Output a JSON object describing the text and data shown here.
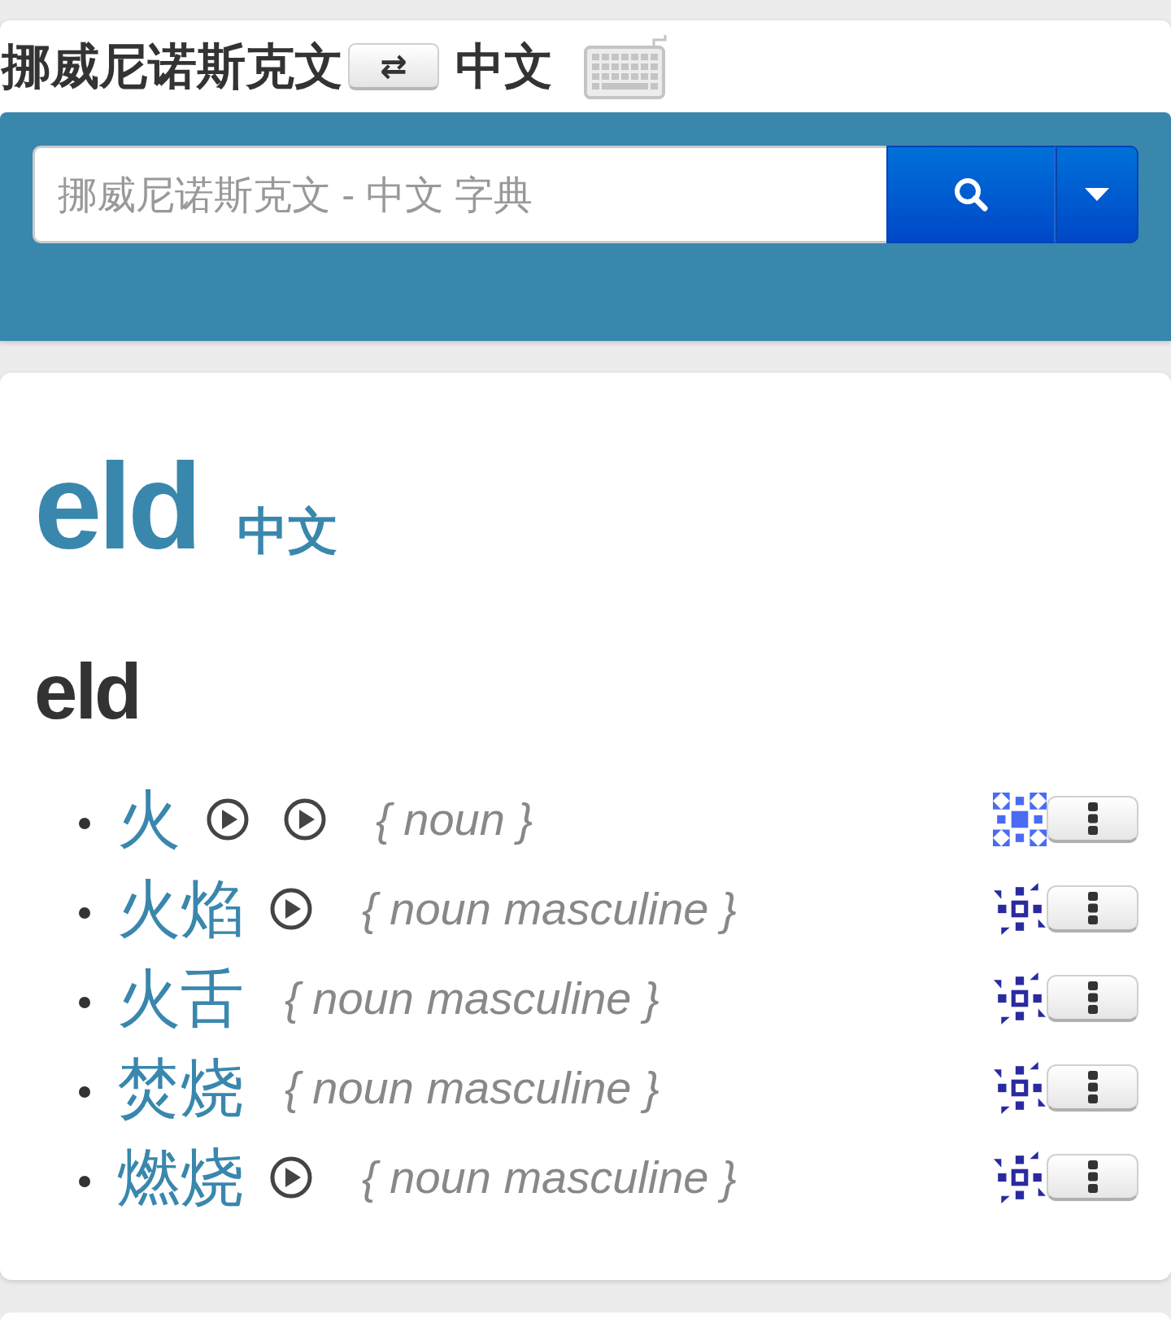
{
  "header": {
    "source_language": "挪威尼诺斯克文",
    "swap_button": "⇄",
    "target_language": "中文"
  },
  "search": {
    "placeholder": "挪威尼诺斯克文 - 中文 字典"
  },
  "entry": {
    "title": "eld",
    "title_language": "中文",
    "headword": "eld",
    "translations": [
      {
        "term": "火",
        "audio_buttons": [
          {
            "kind": "play"
          },
          {
            "kind": "play"
          }
        ],
        "type": "{ noun }",
        "badge": {
          "kind": "grid",
          "color": "#4a6cf2"
        }
      },
      {
        "term": "火焰",
        "audio_buttons": [
          {
            "kind": "play"
          }
        ],
        "type": "{ noun masculine }",
        "badge": {
          "kind": "burst",
          "color": "#2a2aa0"
        }
      },
      {
        "term": "火舌",
        "type": "{ noun masculine }",
        "badge": {
          "kind": "burst",
          "color": "#2a2aa0"
        }
      },
      {
        "term": "焚烧",
        "type": "{ noun masculine }",
        "badge": {
          "kind": "burst",
          "color": "#2a2aa0"
        }
      },
      {
        "term": "燃烧",
        "audio_buttons": [
          {
            "kind": "play"
          }
        ],
        "type": "{ noun masculine }",
        "badge": {
          "kind": "burst",
          "color": "#2a2aa0"
        }
      }
    ]
  }
}
